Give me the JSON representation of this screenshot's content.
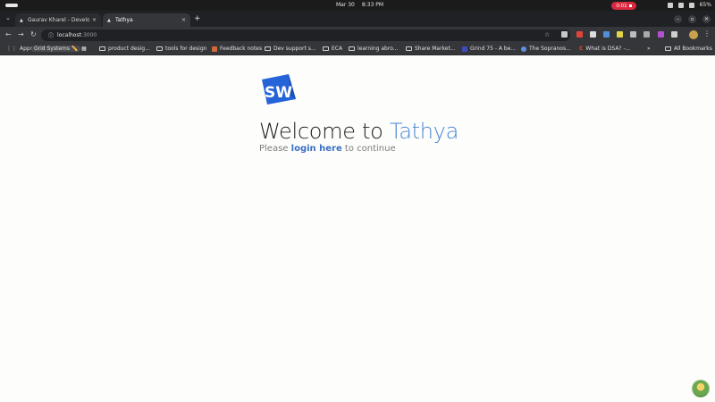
{
  "os": {
    "date": "Mar 30",
    "time": "8:33 PM",
    "recording": "0:01",
    "battery": "65%"
  },
  "tabs": [
    {
      "title": "Gaurav Kharel - Develop",
      "active": false
    },
    {
      "title": "Tathya",
      "active": true
    }
  ],
  "address": {
    "host": "localhost",
    "port": ":3000"
  },
  "bookmarks": [
    {
      "label": "Apps",
      "icon": "apps-grid-icon"
    },
    {
      "label": "Grid Systems ✏️",
      "icon": "none"
    },
    {
      "label": "product desig...",
      "icon": "folder-icon"
    },
    {
      "label": "tools for design",
      "icon": "folder-icon"
    },
    {
      "label": "Feedback notes",
      "icon": "bookmark-icon"
    },
    {
      "label": "Dev support s...",
      "icon": "folder-icon"
    },
    {
      "label": "ECA",
      "icon": "folder-icon"
    },
    {
      "label": "learning abro...",
      "icon": "folder-icon"
    },
    {
      "label": "Share Market...",
      "icon": "folder-icon"
    },
    {
      "label": "Grind 75 - A be...",
      "icon": "site-icon"
    },
    {
      "label": "The Sopranos...",
      "icon": "site-icon"
    },
    {
      "label": "What is DSA? -...",
      "icon": "site-icon"
    },
    {
      "label": "All Bookmarks",
      "icon": "folder-icon"
    }
  ],
  "page": {
    "logo_text": "SW",
    "welcome_prefix": "Welcome to ",
    "brand": "Tathya",
    "sub_prefix": "Please ",
    "login_link": "login here",
    "sub_suffix": " to continue"
  },
  "colors": {
    "brand_blue": "#4a88d6",
    "logo_blue": "#2563d9",
    "link_blue": "#3a6fc4",
    "record_red": "#d8293f"
  }
}
